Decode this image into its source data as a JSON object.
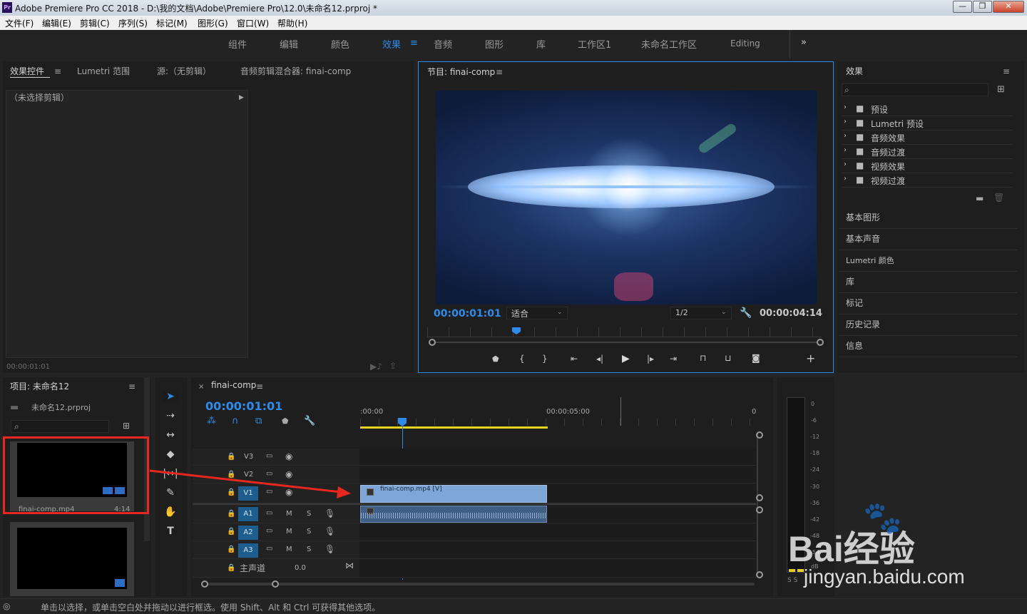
{
  "window": {
    "app_icon": "Pr",
    "title": "Adobe Premiere Pro CC 2018 - D:\\我的文档\\Adobe\\Premiere Pro\\12.0\\未命名12.prproj *",
    "minimize": "—",
    "maximize": "❐",
    "close": "✕"
  },
  "menu": [
    "文件(F)",
    "编辑(E)",
    "剪辑(C)",
    "序列(S)",
    "标记(M)",
    "图形(G)",
    "窗口(W)",
    "帮助(H)"
  ],
  "workspaces": [
    "组件",
    "编辑",
    "颜色",
    "效果",
    "音频",
    "图形",
    "库",
    "工作区1",
    "未命名工作区",
    "Editing"
  ],
  "workspace_active": "效果",
  "workspace_more": "»",
  "source_panel": {
    "tabs": [
      "效果控件",
      "Lumetri 范围",
      "源:（无剪辑）",
      "音频剪辑混合器: finai-comp"
    ],
    "no_clip": "（未选择剪辑）",
    "timecode": "00:00:01:01"
  },
  "program_monitor": {
    "title": "节目: finai-comp",
    "timecode": "00:00:01:01",
    "fit": "适合",
    "resolution": "1/2",
    "duration": "00:00:04:14"
  },
  "effects_panel": {
    "title": "效果",
    "folders": [
      "预设",
      "Lumetri 预设",
      "音频效果",
      "音频过渡",
      "视频效果",
      "视频过渡"
    ],
    "sections": [
      "基本图形",
      "基本声音",
      "Lumetri 颜色",
      "库",
      "标记",
      "历史记录",
      "信息"
    ]
  },
  "project_panel": {
    "title": "项目: 未命名12",
    "file": "未命名12.prproj",
    "items": [
      {
        "name": "finai-comp.mp4",
        "duration": "4:14"
      }
    ]
  },
  "timeline": {
    "sequence": "finai-comp",
    "timecode": "00:00:01:01",
    "ruler": [
      ":00:00",
      "00:00:05:00",
      "0"
    ],
    "video_tracks": [
      "V3",
      "V2",
      "V1"
    ],
    "audio_tracks": [
      "A1",
      "A2",
      "A3"
    ],
    "master_label": "主声道",
    "master_value": "0.0",
    "clip_video": "finai-comp.mp4 [V]",
    "icons": {
      "mute": "M",
      "solo": "S"
    }
  },
  "audio_meter": {
    "scale": [
      "0",
      "-6",
      "-12",
      "-18",
      "-24",
      "-30",
      "-36",
      "-42",
      "-48",
      "-54"
    ],
    "unit": "dB",
    "bottom": "S S"
  },
  "status_bar": "单击以选择，或单击空白处并拖动以进行框选。使用 Shift、Alt 和 Ctrl 可获得其他选项。",
  "watermark": {
    "brand": "Bai经验",
    "url": "jingyan.baidu.com"
  },
  "colors": {
    "accent": "#2d8ceb",
    "annotation_red": "#e8281e",
    "clip_video": "#7ea6d6",
    "clip_audio": "#3f5f86"
  }
}
